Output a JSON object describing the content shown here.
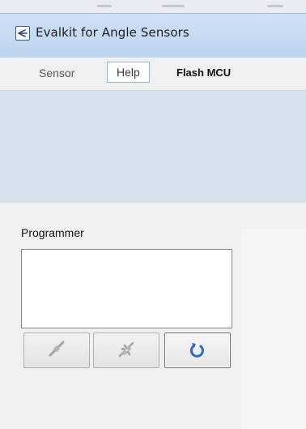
{
  "window": {
    "title": "Evalkit for Angle Sensors",
    "icon": "angle-sensor-app-icon"
  },
  "menu": {
    "items": [
      {
        "label": "Sensor"
      },
      {
        "label": "Help"
      },
      {
        "label": "Flash MCU"
      }
    ]
  },
  "programmer": {
    "label": "Programmer",
    "buttons": [
      {
        "icon": "connect-plug-icon",
        "enabled": false
      },
      {
        "icon": "disconnect-plug-icon",
        "enabled": false
      },
      {
        "icon": "refresh-icon",
        "enabled": true
      }
    ]
  },
  "colors": {
    "title_bar": "#c8dbf2",
    "banner": "#d6e1ee",
    "refresh_icon": "#2a6cc7"
  }
}
